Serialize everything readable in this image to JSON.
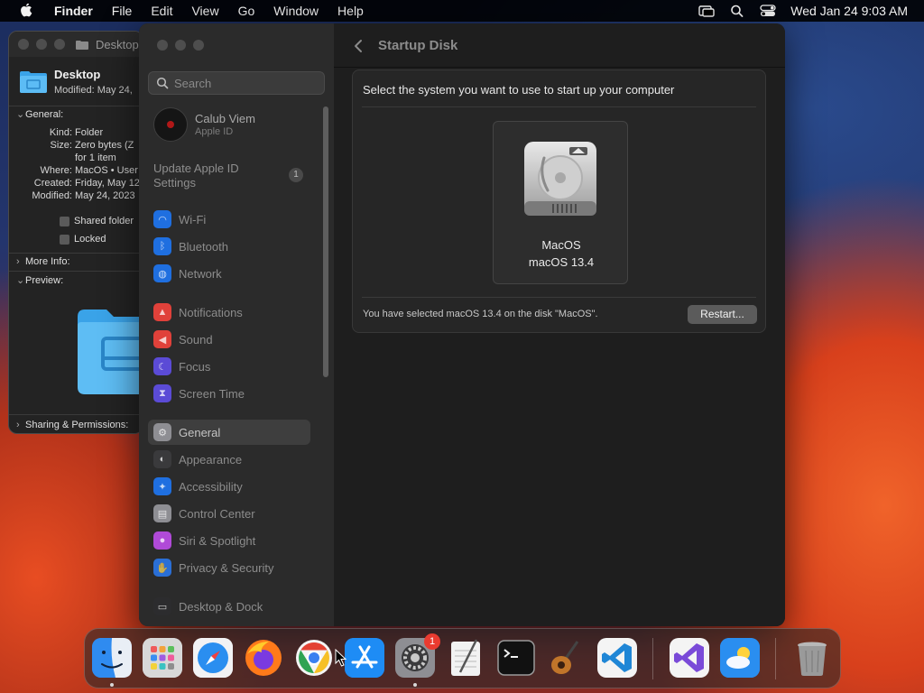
{
  "menubar": {
    "app": "Finder",
    "items": [
      "File",
      "Edit",
      "View",
      "Go",
      "Window",
      "Help"
    ],
    "clock": "Wed Jan 24  9:03 AM"
  },
  "finder": {
    "title": "Desktop",
    "name": "Desktop",
    "modified_header": "Modified: May 24,",
    "general_label": "General:",
    "rows": [
      {
        "key": "Kind:",
        "value": "Folder"
      },
      {
        "key": "Size:",
        "value": "Zero bytes (Z"
      },
      {
        "key": "",
        "value": "for 1 item"
      },
      {
        "key": "Where:",
        "value": "MacOS • User"
      },
      {
        "key": "Created:",
        "value": "Friday, May 12"
      },
      {
        "key": "Modified:",
        "value": "May 24, 2023"
      }
    ],
    "shared_label": "Shared folder",
    "locked_label": "Locked",
    "more_info_label": "More Info:",
    "preview_label": "Preview:",
    "sharing_label": "Sharing & Permissions:"
  },
  "settings": {
    "search_placeholder": "Search",
    "user_name": "Calub Viem",
    "user_sub": "Apple ID",
    "update_label": "Update Apple ID Settings",
    "update_badge": "1",
    "sidebar_items": [
      {
        "label": "Wi-Fi",
        "color": "#1f6fe0"
      },
      {
        "label": "Bluetooth",
        "color": "#1f6fe0"
      },
      {
        "label": "Network",
        "color": "#1f6fe0"
      },
      {
        "label": "Notifications",
        "color": "#e0413a"
      },
      {
        "label": "Sound",
        "color": "#e0413a"
      },
      {
        "label": "Focus",
        "color": "#5b4bd6"
      },
      {
        "label": "Screen Time",
        "color": "#5b4bd6"
      },
      {
        "label": "General",
        "color": "#8e8e93"
      },
      {
        "label": "Appearance",
        "color": "#3a3a3c"
      },
      {
        "label": "Accessibility",
        "color": "#1f6fe0"
      },
      {
        "label": "Control Center",
        "color": "#8e8e93"
      },
      {
        "label": "Siri & Spotlight",
        "color": "#b04ad8"
      },
      {
        "label": "Privacy & Security",
        "color": "#2a6fd6"
      },
      {
        "label": "Desktop & Dock",
        "color": "#2c2c2e"
      }
    ],
    "selected_item": "General",
    "page_title": "Startup Disk",
    "prompt": "Select the system you want to use to start up your computer",
    "disk_name": "MacOS",
    "disk_version": "macOS 13.4",
    "status": "You have selected macOS 13.4 on the disk \"MacOS\".",
    "restart_label": "Restart..."
  },
  "dock": {
    "settings_badge": "1",
    "icon_colors": {
      "finder": "#2f8bf0",
      "launchpad": "#d8d8d8",
      "safari": "#e8e8ea",
      "firefox": "#ff7a1a",
      "chrome": "#f4f4f4",
      "app_store": "#1e8cf5",
      "system_settings": "#8e8e93",
      "textedit": "#f2f2f2",
      "terminal": "#111111",
      "garageband": "#7a4a2a",
      "vscode": "#f4f4f4",
      "visual_studio": "#f4f4f4",
      "weather": "#2a8ef0",
      "trash": "#9a9a9a"
    }
  }
}
